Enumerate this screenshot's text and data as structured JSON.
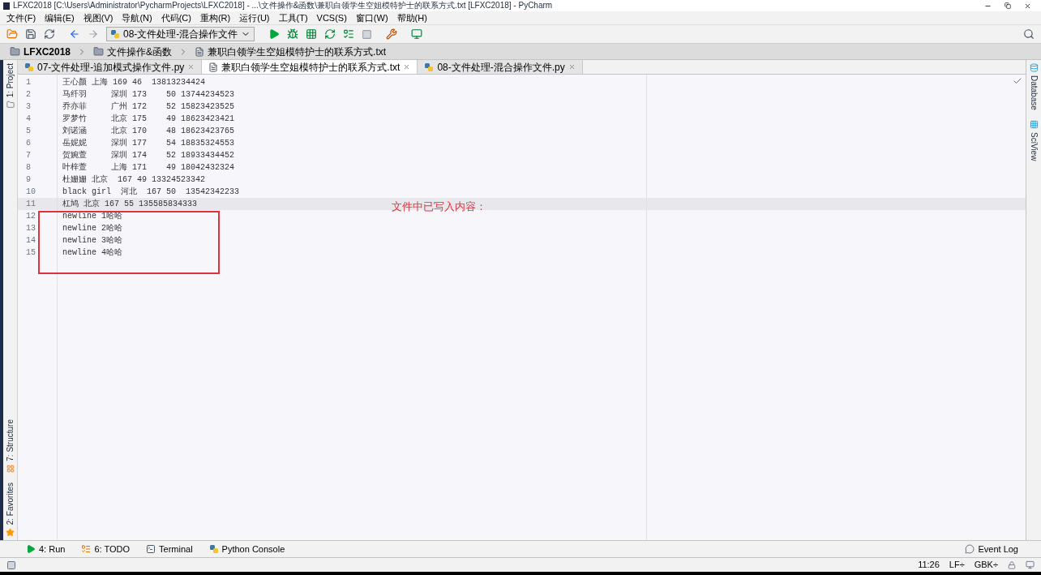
{
  "window": {
    "title": "LFXC2018 [C:\\Users\\Administrator\\PycharmProjects\\LFXC2018] - ...\\文件操作&函数\\兼职白领学生空姐模特护士的联系方式.txt [LFXC2018] - PyCharm"
  },
  "menu": [
    "文件(F)",
    "编辑(E)",
    "视图(V)",
    "导航(N)",
    "代码(C)",
    "重构(R)",
    "运行(U)",
    "工具(T)",
    "VCS(S)",
    "窗口(W)",
    "帮助(H)"
  ],
  "toolbar": {
    "run_config": "08-文件处理-混合操作文件"
  },
  "breadcrumbs": [
    {
      "label": "LFXC2018",
      "kind": "project"
    },
    {
      "label": "文件操作&函数",
      "kind": "folder"
    },
    {
      "label": "兼职白领学生空姐模特护士的联系方式.txt",
      "kind": "file"
    }
  ],
  "tabs": [
    {
      "label": "07-文件处理-追加模式操作文件.py",
      "kind": "py",
      "selected": false
    },
    {
      "label": "兼职白领学生空姐模特护士的联系方式.txt",
      "kind": "txt",
      "selected": true
    },
    {
      "label": "08-文件处理-混合操作文件.py",
      "kind": "py",
      "selected": false
    }
  ],
  "left_tools_top": [
    {
      "label": "1: Project"
    }
  ],
  "left_tools_bottom": [
    {
      "label": "7: Structure",
      "kind": "structure"
    },
    {
      "label": "2: Favorites",
      "kind": "favorites"
    }
  ],
  "right_tools": [
    {
      "label": "Database",
      "kind": "database"
    },
    {
      "label": "SciView",
      "kind": "sciview"
    }
  ],
  "editor": {
    "lines": [
      {
        "number": "1",
        "text": "王心颜 上海 169 46  13813234424",
        "current": false
      },
      {
        "number": "2",
        "text": "马纤羽     深圳 173    50 13744234523",
        "current": false
      },
      {
        "number": "3",
        "text": "乔亦菲     广州 172    52 15823423525",
        "current": false
      },
      {
        "number": "4",
        "text": "罗梦竹     北京 175    49 18623423421",
        "current": false
      },
      {
        "number": "5",
        "text": "刘诺涵     北京 170    48 18623423765",
        "current": false
      },
      {
        "number": "6",
        "text": "岳妮妮     深圳 177    54 18835324553",
        "current": false
      },
      {
        "number": "7",
        "text": "贺婉萱     深圳 174    52 18933434452",
        "current": false
      },
      {
        "number": "8",
        "text": "叶梓萱     上海 171    49 18042432324",
        "current": false
      },
      {
        "number": "9",
        "text": "杜姗姗 北京  167 49 13324523342",
        "current": false
      },
      {
        "number": "10",
        "text": "black girl  河北  167 50  13542342233",
        "current": false
      },
      {
        "number": "11",
        "text": "杠鸠 北京 167 55 135585834333",
        "current": true
      },
      {
        "number": "12",
        "text": "newline 1哈哈",
        "current": false
      },
      {
        "number": "13",
        "text": "newline 2哈哈",
        "current": false
      },
      {
        "number": "14",
        "text": "newline 3哈哈",
        "current": false
      },
      {
        "number": "15",
        "text": "newline 4哈哈",
        "current": false
      }
    ],
    "annotation": "文件中已写入内容："
  },
  "bottom_tools": [
    {
      "label": "4: Run",
      "kind": "run"
    },
    {
      "label": "6: TODO",
      "kind": "todo"
    },
    {
      "label": "Terminal",
      "kind": "terminal"
    },
    {
      "label": "Python Console",
      "kind": "console"
    }
  ],
  "event_log": "Event Log",
  "status": {
    "position": "11:26",
    "line_separator": "LF÷",
    "encoding": "GBK÷"
  }
}
